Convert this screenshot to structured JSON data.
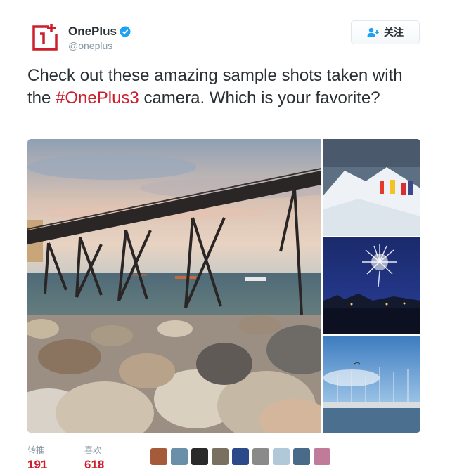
{
  "header": {
    "display_name": "OnePlus",
    "handle": "@oneplus",
    "follow_label": "关注"
  },
  "tweet": {
    "text_before": "Check out these amazing sample shots taken with the ",
    "hashtag": "#OnePlus3",
    "text_after": " camera. Which is your favorite?"
  },
  "media": {
    "photos": [
      "pier-photo",
      "mountain-climbers-photo",
      "fireworks-photo",
      "marina-photo"
    ]
  },
  "stats": {
    "retweets_label": "转推",
    "retweets_count": "191",
    "likes_label": "喜欢",
    "likes_count": "618"
  },
  "likers_count": 9,
  "colors": {
    "brand_red": "#cc1e2c",
    "verified_blue": "#1da1f2",
    "text": "#292f33",
    "muted": "#8899a6"
  }
}
